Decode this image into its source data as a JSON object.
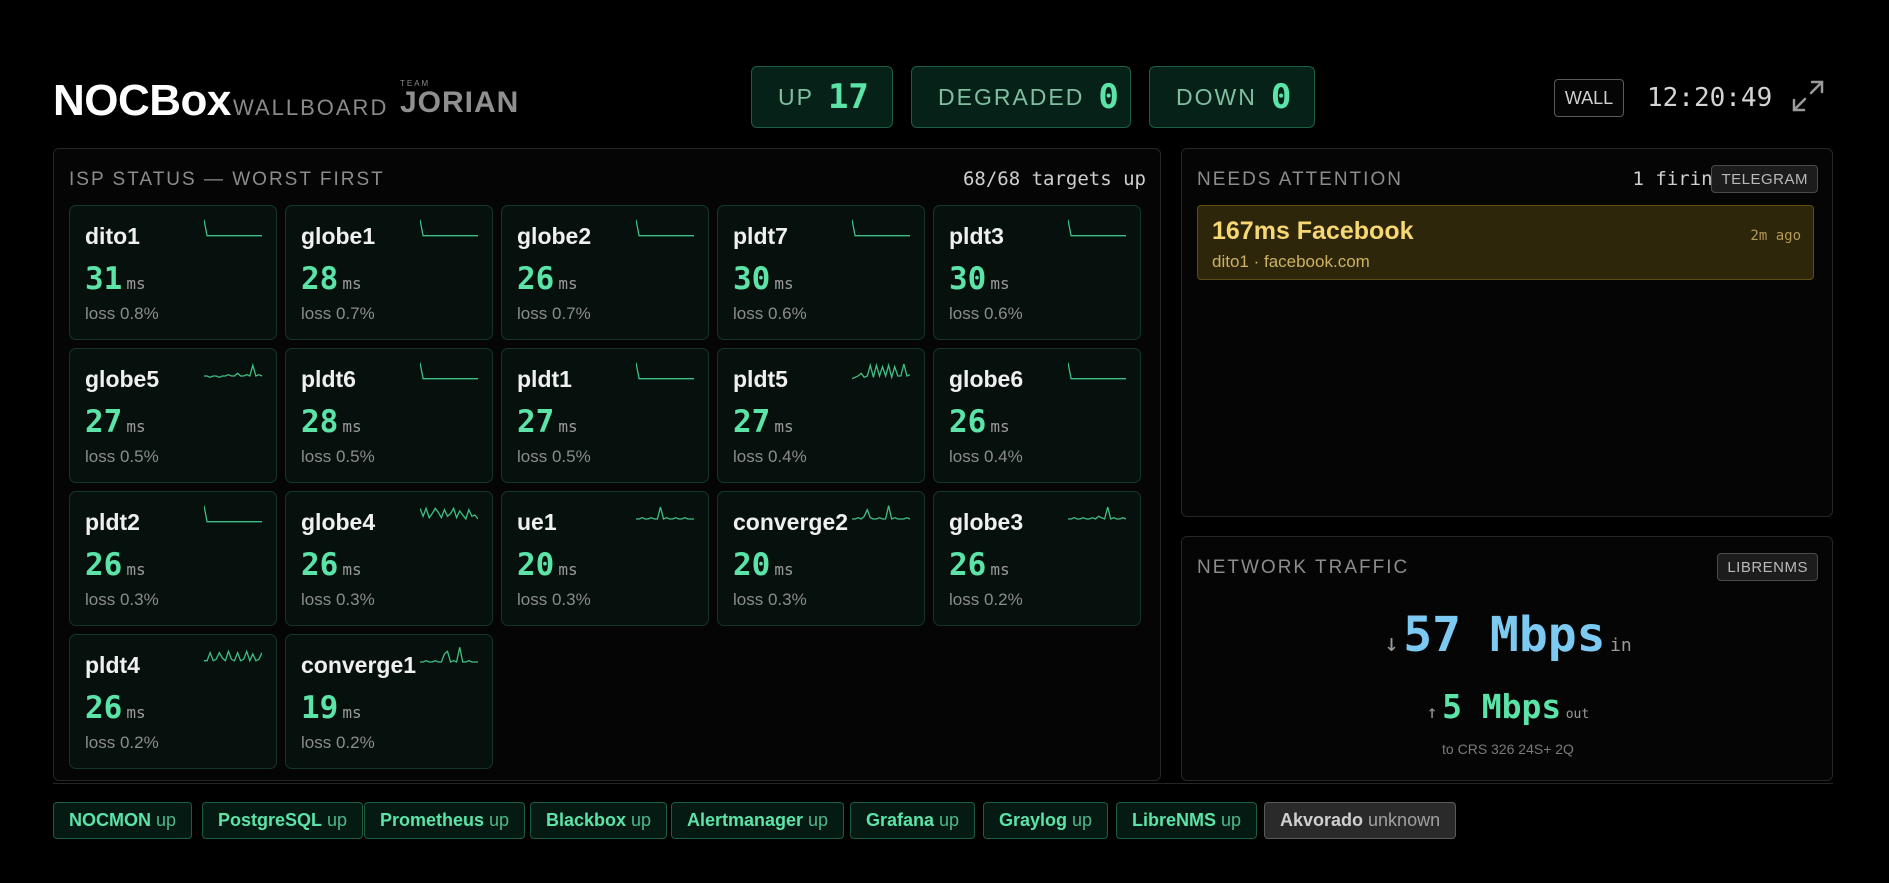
{
  "header": {
    "brand": "NOCBox",
    "subtitle": "WALLBOARD",
    "team_label": "TEAM",
    "team_name": "JORIAN",
    "status": [
      {
        "label": "UP",
        "value": "17"
      },
      {
        "label": "DEGRADED",
        "value": "0"
      },
      {
        "label": "DOWN",
        "value": "0"
      }
    ],
    "wall_button": "WALL",
    "clock": "12:20:49",
    "fullscreen_icon": "fullscreen-icon"
  },
  "isp": {
    "title": "ISP STATUS — WORST FIRST",
    "targets": "68/68 targets up",
    "unit": "ms",
    "tiles": [
      {
        "name": "dito1",
        "latency": "31",
        "loss": "loss 0.8%",
        "spark": [
          2,
          14,
          14,
          14,
          14,
          14,
          14,
          14,
          14,
          14,
          14,
          14,
          14,
          14,
          14,
          14,
          14,
          14,
          14,
          14
        ]
      },
      {
        "name": "globe1",
        "latency": "28",
        "loss": "loss 0.7%",
        "spark": [
          2,
          14,
          14,
          14,
          14,
          14,
          14,
          14,
          14,
          14,
          14,
          14,
          14,
          14,
          14,
          14,
          14,
          14,
          14,
          14
        ]
      },
      {
        "name": "globe2",
        "latency": "26",
        "loss": "loss 0.7%",
        "spark": [
          2,
          14,
          14,
          14,
          14,
          14,
          14,
          14,
          14,
          14,
          14,
          14,
          14,
          14,
          14,
          14,
          14,
          14,
          14,
          14
        ]
      },
      {
        "name": "pldt7",
        "latency": "30",
        "loss": "loss 0.6%",
        "spark": [
          2,
          14,
          14,
          14,
          14,
          14,
          14,
          14,
          14,
          14,
          14,
          14,
          14,
          14,
          14,
          14,
          14,
          14,
          14,
          14
        ]
      },
      {
        "name": "pldt3",
        "latency": "30",
        "loss": "loss 0.6%",
        "spark": [
          2,
          14,
          14,
          14,
          14,
          14,
          14,
          14,
          14,
          14,
          14,
          14,
          14,
          14,
          14,
          14,
          14,
          14,
          14,
          14
        ]
      },
      {
        "name": "globe5",
        "latency": "27",
        "loss": "loss 0.5%",
        "spark": [
          12,
          12,
          13,
          12,
          12,
          13,
          12,
          12,
          11,
          12,
          12,
          10,
          12,
          12,
          11,
          12,
          4,
          12,
          11,
          12
        ]
      },
      {
        "name": "pldt6",
        "latency": "28",
        "loss": "loss 0.5%",
        "spark": [
          2,
          14,
          14,
          14,
          14,
          14,
          14,
          14,
          14,
          14,
          14,
          14,
          14,
          14,
          14,
          14,
          14,
          14,
          14,
          14
        ]
      },
      {
        "name": "pldt1",
        "latency": "27",
        "loss": "loss 0.5%",
        "spark": [
          2,
          14,
          14,
          14,
          14,
          14,
          14,
          14,
          14,
          14,
          14,
          14,
          14,
          14,
          14,
          14,
          14,
          14,
          14,
          14
        ]
      },
      {
        "name": "pldt5",
        "latency": "27",
        "loss": "loss 0.4%",
        "spark": [
          14,
          13,
          12,
          10,
          13,
          12,
          4,
          13,
          4,
          12,
          5,
          12,
          4,
          13,
          5,
          12,
          12,
          3,
          12,
          11
        ]
      },
      {
        "name": "globe6",
        "latency": "26",
        "loss": "loss 0.4%",
        "spark": [
          2,
          14,
          14,
          14,
          14,
          14,
          14,
          14,
          14,
          14,
          14,
          14,
          14,
          14,
          14,
          14,
          14,
          14,
          14,
          14
        ]
      },
      {
        "name": "pldt2",
        "latency": "26",
        "loss": "loss 0.3%",
        "spark": [
          2,
          14,
          14,
          14,
          14,
          14,
          14,
          14,
          14,
          14,
          14,
          14,
          14,
          14,
          14,
          14,
          14,
          14,
          14,
          14
        ]
      },
      {
        "name": "globe4",
        "latency": "26",
        "loss": "loss 0.3%",
        "spark": [
          4,
          10,
          4,
          11,
          8,
          4,
          7,
          11,
          5,
          10,
          8,
          4,
          11,
          6,
          9,
          12,
          5,
          10,
          9,
          12
        ]
      },
      {
        "name": "ue1",
        "latency": "20",
        "loss": "loss 0.3%",
        "spark": [
          12,
          12,
          11,
          12,
          12,
          11,
          12,
          12,
          3,
          12,
          11,
          12,
          12,
          11,
          12,
          12,
          11,
          12,
          12,
          12
        ]
      },
      {
        "name": "converge2",
        "latency": "20",
        "loss": "loss 0.3%",
        "spark": [
          12,
          12,
          11,
          12,
          10,
          5,
          11,
          12,
          12,
          11,
          12,
          12,
          2,
          12,
          11,
          12,
          12,
          12,
          11,
          12
        ]
      },
      {
        "name": "globe3",
        "latency": "26",
        "loss": "loss 0.2%",
        "spark": [
          12,
          12,
          11,
          12,
          12,
          11,
          12,
          12,
          11,
          12,
          10,
          11,
          12,
          3,
          12,
          11,
          12,
          12,
          11,
          12
        ]
      },
      {
        "name": "pldt4",
        "latency": "26",
        "loss": "loss 0.2%",
        "spark": [
          11,
          11,
          5,
          11,
          10,
          5,
          9,
          11,
          4,
          10,
          11,
          5,
          11,
          10,
          4,
          11,
          6,
          11,
          10,
          5
        ]
      },
      {
        "name": "converge1",
        "latency": "19",
        "loss": "loss 0.2%",
        "spark": [
          12,
          12,
          11,
          12,
          12,
          11,
          12,
          12,
          6,
          4,
          12,
          11,
          12,
          1,
          12,
          12,
          11,
          12,
          12,
          12
        ]
      }
    ]
  },
  "attention": {
    "title": "NEEDS ATTENTION",
    "count": "1 firing",
    "tag": "TELEGRAM",
    "alerts": [
      {
        "title": "167ms Facebook",
        "subtitle": "dito1 · facebook.com",
        "age": "2m ago"
      }
    ]
  },
  "traffic": {
    "title": "NETWORK TRAFFIC",
    "tag": "LIBRENMS",
    "in_arrow": "↓",
    "in_value": "57 Mbps",
    "in_unit": "in",
    "out_arrow": "↑",
    "out_value": "5 Mbps",
    "out_unit": "out",
    "destination": "to CRS 326 24S+ 2Q"
  },
  "services": [
    {
      "name": "NOCMON",
      "status": "up"
    },
    {
      "name": "PostgreSQL",
      "status": "up"
    },
    {
      "name": "Prometheus",
      "status": "up"
    },
    {
      "name": "Blackbox",
      "status": "up"
    },
    {
      "name": "Alertmanager",
      "status": "up"
    },
    {
      "name": "Grafana",
      "status": "up"
    },
    {
      "name": "Graylog",
      "status": "up"
    },
    {
      "name": "LibreNMS",
      "status": "up"
    },
    {
      "name": "Akvorado",
      "status": "unknown"
    }
  ],
  "colors": {
    "accent_green": "#5be3a8",
    "alert_yellow": "#f6d774",
    "traffic_blue": "#7cc9f2",
    "tile_border": "#14352a"
  }
}
